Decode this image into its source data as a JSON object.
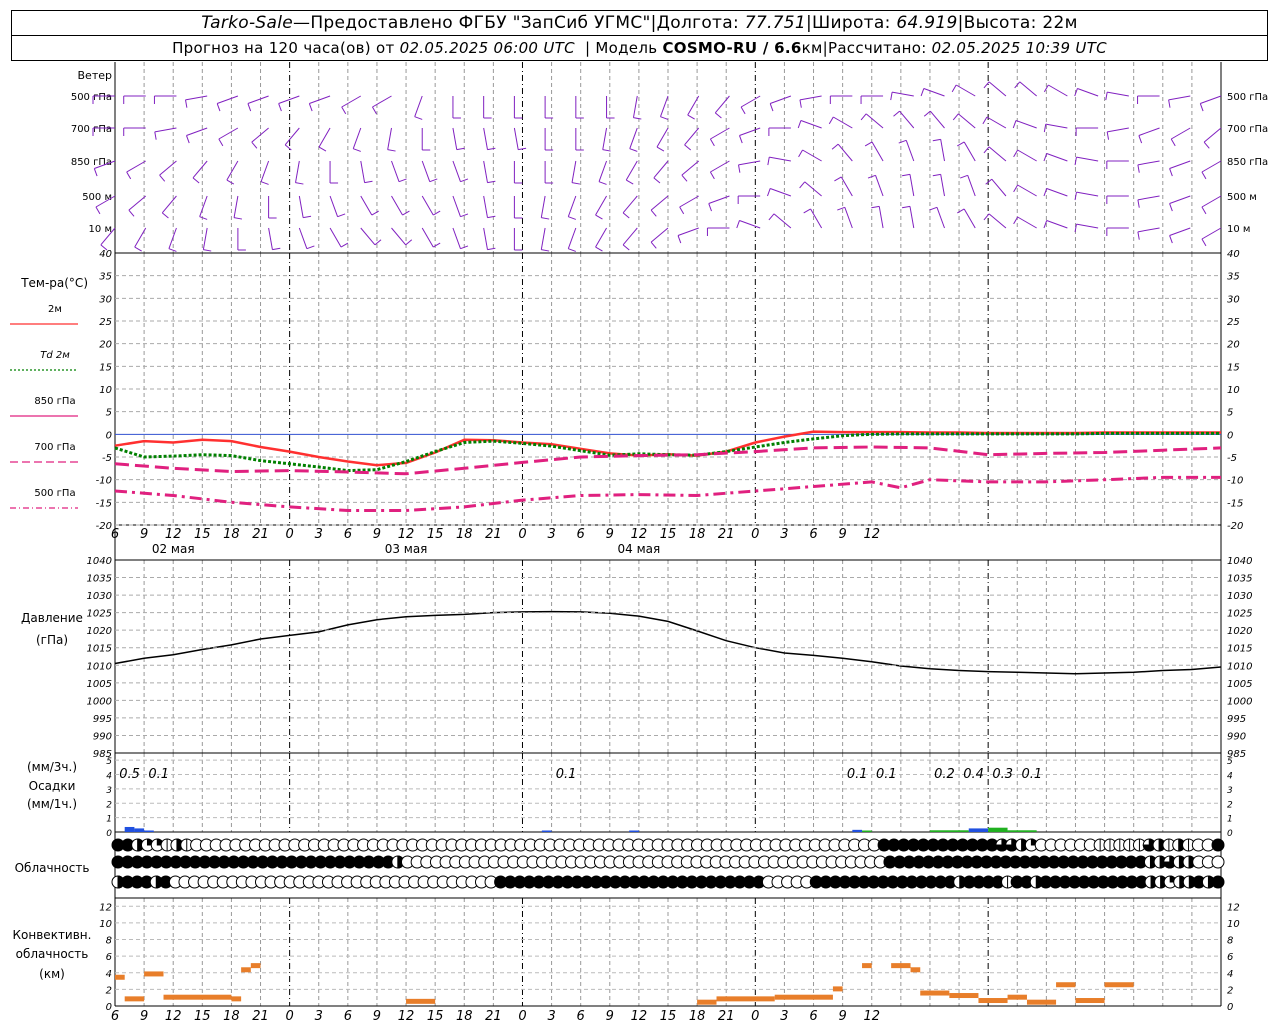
{
  "header": {
    "station": "Tarko-Sale",
    "dash": " — ",
    "provider": "Предоставлено ФГБУ \"ЗапСиб УГМС\"",
    "lon_label": "Долгота:",
    "lon_value": "77.751",
    "lat_label": "Широта:",
    "lat_value": "64.919",
    "alt_label": "Высота:",
    "alt_value": "22м",
    "sep": " | ",
    "forecast_prefix": "Прогноз на 120 часа(ов) от",
    "forecast_start": "02.05.2025 06:00 UTC",
    "model_label": "Модель",
    "model_name": "COSMO-RU / 6.6",
    "model_unit": "км",
    "calc_label": "Рассчитано:",
    "calc_time": "02.05.2025 10:39 UTC"
  },
  "panels": {
    "wind_title": "Ветер",
    "wind_levels": [
      "500 гПа",
      "700 гПа",
      "850 гПа",
      "500 м",
      "10  м"
    ],
    "temp_title": "Тем-ра(°C)",
    "temp_legend": [
      {
        "label": "2м",
        "color": "#ff3030",
        "dash": "solid"
      },
      {
        "label": "Td  2м",
        "color": "#008000",
        "dash": "dotted"
      },
      {
        "label": "850 гПа",
        "color": "#e0207f",
        "dash": "solid"
      },
      {
        "label": "700 гПа",
        "color": "#e0207f",
        "dash": "dashed"
      },
      {
        "label": "500 гПа",
        "color": "#e0207f",
        "dash": "dashdot"
      }
    ],
    "pressure_title": "Давление",
    "pressure_unit": "(гПа)",
    "precip_unit_3h": "(мм/3ч.)",
    "precip_title": "Осадки",
    "precip_unit_1h": "(мм/1ч.)",
    "cloud_title": "Облачность",
    "conv_title_1": "Конвективн.",
    "conv_title_2": "облачность",
    "conv_unit": "(км)"
  },
  "axis": {
    "hour_ticks": [
      "6",
      "9",
      "12",
      "15",
      "18",
      "21",
      "0",
      "3",
      "6",
      "9",
      "12",
      "15",
      "18",
      "21",
      "0",
      "3",
      "6",
      "9",
      "12",
      "15",
      "18",
      "21",
      "0",
      "3",
      "6",
      "9",
      "12"
    ],
    "dates": [
      "02 мая",
      "03 мая",
      "04 мая"
    ],
    "temp_ticks": [
      40,
      35,
      30,
      25,
      20,
      15,
      10,
      5,
      0,
      -5,
      -10,
      -15,
      -20
    ],
    "pressure_ticks": [
      1040,
      1035,
      1030,
      1025,
      1020,
      1015,
      1010,
      1005,
      1000,
      995,
      990,
      985
    ],
    "precip_ticks": [
      5,
      4,
      3,
      2,
      1,
      0
    ],
    "conv_ticks": [
      12,
      10,
      8,
      6,
      4,
      2,
      0
    ]
  },
  "chart_data": {
    "type": "line",
    "x_unit": "hours since 02.05.2025 06:00 UTC",
    "series": [
      {
        "name": "2м",
        "color": "#ff3030",
        "x": [
          0,
          3,
          6,
          9,
          12,
          15,
          18,
          21,
          24,
          27,
          30,
          33,
          36,
          39,
          42,
          45,
          48,
          51,
          54,
          57,
          60,
          63,
          66,
          69,
          72,
          75,
          78,
          81,
          84,
          87,
          90,
          93,
          96,
          99,
          102,
          105,
          108,
          111,
          114
        ],
        "y": [
          -2.5,
          -1.5,
          -1.8,
          -1.2,
          -1.5,
          -2.8,
          -3.8,
          -5.0,
          -6.0,
          -6.8,
          -6.3,
          -4.0,
          -1.2,
          -1.3,
          -1.8,
          -2.2,
          -3.2,
          -4.2,
          -4.7,
          -4.4,
          -4.7,
          -3.8,
          -1.8,
          -0.5,
          0.6,
          0.5,
          0.5,
          0.5,
          0.4,
          0.4,
          0.3,
          0.3,
          0.3,
          0.3,
          0.4,
          0.4,
          0.4,
          0.4,
          0.4
        ]
      },
      {
        "name": "Td  2м",
        "color": "#008000",
        "x": [
          0,
          3,
          6,
          9,
          12,
          15,
          18,
          21,
          24,
          27,
          30,
          33,
          36,
          39,
          42,
          45,
          48,
          51,
          54,
          57,
          60,
          63,
          66,
          69,
          72,
          75,
          78,
          81,
          84,
          87,
          90,
          93,
          96,
          99,
          102,
          105,
          108,
          111,
          114
        ],
        "y": [
          -3.0,
          -5.0,
          -4.8,
          -4.5,
          -4.7,
          -5.8,
          -6.5,
          -7.2,
          -8.0,
          -7.8,
          -6.0,
          -3.8,
          -1.8,
          -1.5,
          -2.0,
          -2.6,
          -3.6,
          -4.6,
          -4.3,
          -4.5,
          -4.6,
          -3.8,
          -2.8,
          -1.8,
          -1.0,
          -0.3,
          0.0,
          0.1,
          0.1,
          0.1,
          0.1,
          0.1,
          0.1,
          0.1,
          0.2,
          0.2,
          0.2,
          0.2,
          0.2
        ]
      },
      {
        "name": "700 гПа",
        "color": "#e0207f",
        "x": [
          0,
          6,
          12,
          18,
          24,
          30,
          36,
          42,
          48,
          54,
          60,
          66,
          72,
          78,
          84,
          90,
          96,
          102,
          108,
          114
        ],
        "y": [
          -6.5,
          -7.5,
          -8.2,
          -8.0,
          -8.3,
          -8.7,
          -7.5,
          -6.2,
          -5.0,
          -4.7,
          -4.5,
          -3.8,
          -3.0,
          -2.8,
          -3.0,
          -4.5,
          -4.2,
          -4.0,
          -3.5,
          -3.0
        ]
      },
      {
        "name": "500 гПа",
        "color": "#e0207f",
        "x": [
          0,
          6,
          12,
          18,
          24,
          30,
          36,
          42,
          48,
          54,
          60,
          66,
          72,
          78,
          81,
          84,
          90,
          96,
          102,
          108,
          114
        ],
        "y": [
          -12.5,
          -13.5,
          -15.0,
          -16.0,
          -16.8,
          -16.8,
          -16.0,
          -14.5,
          -13.5,
          -13.3,
          -13.5,
          -12.5,
          -11.5,
          -10.5,
          -11.8,
          -10.0,
          -10.5,
          -10.5,
          -10.0,
          -9.5,
          -9.5
        ]
      },
      {
        "name": "Давление",
        "color": "#000000",
        "x": [
          0,
          3,
          6,
          9,
          12,
          15,
          18,
          21,
          24,
          27,
          30,
          33,
          36,
          39,
          42,
          45,
          48,
          51,
          54,
          57,
          60,
          63,
          66,
          69,
          72,
          75,
          78,
          81,
          84,
          87,
          90,
          93,
          96,
          99,
          102,
          105,
          108,
          111,
          114
        ],
        "y": [
          1010.5,
          1012.0,
          1013.0,
          1014.5,
          1015.8,
          1017.5,
          1018.5,
          1019.5,
          1021.5,
          1023.0,
          1023.8,
          1024.2,
          1024.5,
          1025.0,
          1025.2,
          1025.3,
          1025.2,
          1024.8,
          1024.0,
          1022.5,
          1019.8,
          1017.0,
          1015.0,
          1013.5,
          1012.8,
          1012.0,
          1011.0,
          1009.8,
          1009.0,
          1008.5,
          1008.2,
          1008.0,
          1007.8,
          1007.6,
          1007.8,
          1008.0,
          1008.5,
          1008.8,
          1009.5
        ]
      }
    ],
    "precip_labels": [
      {
        "x": 1.5,
        "text": "0.5"
      },
      {
        "x": 4.5,
        "text": "0.1"
      },
      {
        "x": 46.5,
        "text": "0.1"
      },
      {
        "x": 76.5,
        "text": "0.1"
      },
      {
        "x": 79.5,
        "text": "0.1"
      },
      {
        "x": 85.5,
        "text": "0.2"
      },
      {
        "x": 88.5,
        "text": "0.4"
      },
      {
        "x": 91.5,
        "text": "0.3"
      },
      {
        "x": 94.5,
        "text": "0.1"
      }
    ],
    "precip_bars": [
      {
        "x0": 1,
        "x1": 2,
        "v": 0.35,
        "color": "#2050e0"
      },
      {
        "x0": 2,
        "x1": 3,
        "v": 0.25,
        "color": "#2050e0"
      },
      {
        "x0": 3,
        "x1": 4,
        "v": 0.1,
        "color": "#2050e0"
      },
      {
        "x0": 44,
        "x1": 45,
        "v": 0.08,
        "color": "#2050e0"
      },
      {
        "x0": 53,
        "x1": 54,
        "v": 0.06,
        "color": "#2050e0"
      },
      {
        "x0": 76,
        "x1": 77,
        "v": 0.15,
        "color": "#2050e0"
      },
      {
        "x0": 77,
        "x1": 78,
        "v": 0.06,
        "color": "#20b020"
      },
      {
        "x0": 84,
        "x1": 88,
        "v": 0.12,
        "color": "#20b020"
      },
      {
        "x0": 88,
        "x1": 90,
        "v": 0.25,
        "color": "#2050e0"
      },
      {
        "x0": 90,
        "x1": 92,
        "v": 0.3,
        "color": "#20b020"
      },
      {
        "x0": 92,
        "x1": 95,
        "v": 0.12,
        "color": "#20b020"
      }
    ],
    "convective_bars": [
      {
        "x0": 0,
        "x1": 1,
        "v": 3.4
      },
      {
        "x0": 1,
        "x1": 3,
        "v": 0.8
      },
      {
        "x0": 3,
        "x1": 5,
        "v": 3.8
      },
      {
        "x0": 5,
        "x1": 12,
        "v": 1.0
      },
      {
        "x0": 12,
        "x1": 13,
        "v": 0.8
      },
      {
        "x0": 13,
        "x1": 14,
        "v": 4.3
      },
      {
        "x0": 14,
        "x1": 15,
        "v": 4.8
      },
      {
        "x0": 30,
        "x1": 33,
        "v": 0.5
      },
      {
        "x0": 60,
        "x1": 62,
        "v": 0.4
      },
      {
        "x0": 62,
        "x1": 68,
        "v": 0.8
      },
      {
        "x0": 68,
        "x1": 74,
        "v": 1.0
      },
      {
        "x0": 74,
        "x1": 75,
        "v": 2.0
      },
      {
        "x0": 77,
        "x1": 78,
        "v": 4.8
      },
      {
        "x0": 80,
        "x1": 82,
        "v": 4.8
      },
      {
        "x0": 82,
        "x1": 83,
        "v": 4.3
      },
      {
        "x0": 83,
        "x1": 86,
        "v": 1.5
      },
      {
        "x0": 86,
        "x1": 89,
        "v": 1.2
      },
      {
        "x0": 89,
        "x1": 92,
        "v": 0.6
      },
      {
        "x0": 92,
        "x1": 94,
        "v": 1.0
      },
      {
        "x0": 94,
        "x1": 97,
        "v": 0.4
      },
      {
        "x0": 97,
        "x1": 99,
        "v": 2.5
      },
      {
        "x0": 99,
        "x1": 102,
        "v": 0.6
      },
      {
        "x0": 102,
        "x1": 105,
        "v": 2.5
      }
    ],
    "cloud_rows": [
      "FFHQQDHDEEEEEEEEEEEEEEEEEEEEEEEEEEEEEEEEEEEEEEEEEEEEEEEEEEEEEEEEEEEEEEEEEEEEEEFFFFFFFFFFFFTTHQEEEEEEDDDDDTHDHDEEF",
      "FFFFFFFFFFFFFFFFFFFFFFFFFFFFFHEEEEEEEEEEEEEEEEEEEEEEEEEEEEEEEEEEEEEEEEEEEEEEEEEEFFFFFFFFFFFFFFFFFFFFFFFFFFFHHTHHEEE",
      "HFFFHFEEEEEEEEEEEEEEEEEEEEEEEEEEEEEEEEEEFFFFFFFFFFFFFFFFFFFFFFFFFFFFEEEEEFFFFFFFFFFFFFFFHFFFFDFFHFFFFFFFFFFFHHQHHFHF"
    ],
    "wind": {
      "levels": [
        "500 гПа",
        "700 гПа",
        "850 гПа",
        "500 м",
        "10 м"
      ],
      "directions_deg": [
        [
          270,
          270,
          270,
          260,
          250,
          250,
          250,
          250,
          240,
          240,
          200,
          180,
          180,
          180,
          180,
          180,
          180,
          190,
          200,
          210,
          220,
          240,
          250,
          260,
          270,
          270,
          280,
          290,
          300,
          310,
          310,
          300,
          290,
          280,
          270,
          260,
          250
        ],
        [
          270,
          270,
          260,
          250,
          240,
          230,
          220,
          210,
          200,
          190,
          180,
          170,
          170,
          170,
          180,
          180,
          190,
          200,
          210,
          220,
          240,
          250,
          270,
          290,
          300,
          310,
          320,
          320,
          310,
          300,
          290,
          280,
          270,
          260,
          250,
          240,
          230
        ],
        [
          250,
          240,
          230,
          220,
          210,
          200,
          190,
          180,
          170,
          160,
          160,
          160,
          170,
          180,
          180,
          190,
          200,
          210,
          220,
          230,
          240,
          260,
          280,
          300,
          320,
          330,
          340,
          350,
          330,
          310,
          300,
          290,
          280,
          270,
          260,
          250,
          240
        ],
        [
          240,
          230,
          220,
          200,
          190,
          180,
          170,
          160,
          150,
          150,
          150,
          160,
          170,
          180,
          190,
          200,
          210,
          220,
          230,
          240,
          250,
          270,
          290,
          310,
          330,
          340,
          350,
          350,
          340,
          320,
          300,
          290,
          280,
          270,
          260,
          250,
          240
        ],
        [
          220,
          210,
          200,
          190,
          180,
          170,
          160,
          150,
          140,
          140,
          150,
          160,
          170,
          180,
          190,
          200,
          210,
          220,
          230,
          250,
          270,
          290,
          310,
          330,
          340,
          350,
          350,
          340,
          330,
          310,
          300,
          290,
          280,
          270,
          260,
          250,
          240
        ]
      ],
      "color": "#8020c0"
    }
  }
}
